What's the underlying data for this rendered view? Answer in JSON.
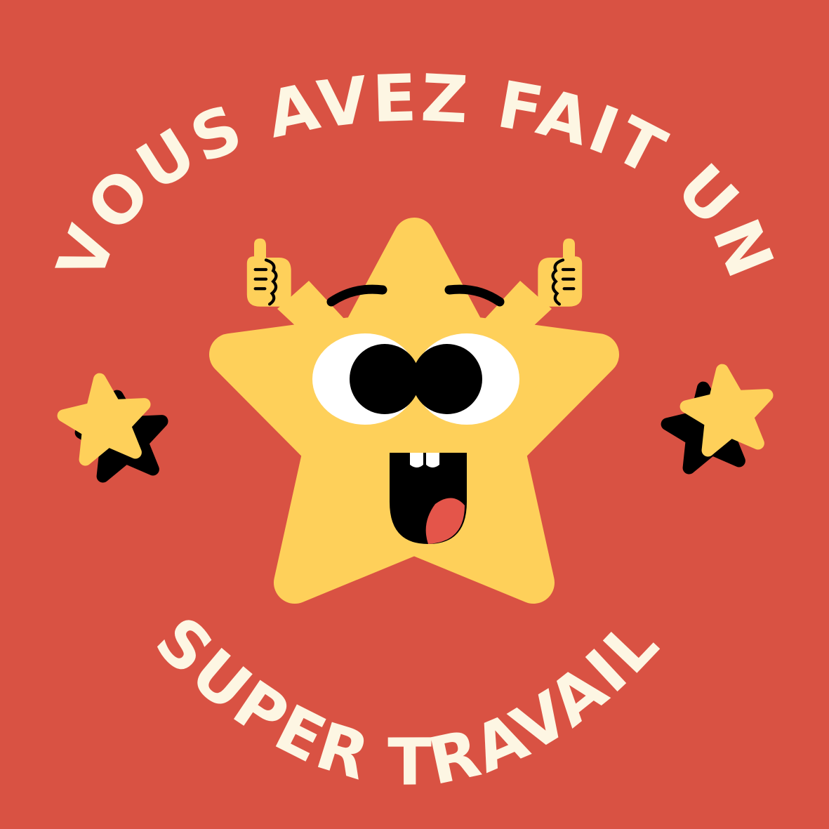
{
  "colors": {
    "background": "#d95243",
    "text": "#fdf6e3",
    "star": "#fed05a",
    "outline": "#000000",
    "eye_white": "#ffffff",
    "tongue": "#e4554a"
  },
  "headline": {
    "top": "VOUS AVEZ FAIT UN",
    "bottom": "SUPER TRAVAIL"
  },
  "illustration": {
    "main": "smiling-star-mascot",
    "left_hand": "thumbs-up-icon",
    "right_hand": "thumbs-up-icon",
    "decorations": [
      "small-star-icon",
      "small-star-icon"
    ]
  }
}
